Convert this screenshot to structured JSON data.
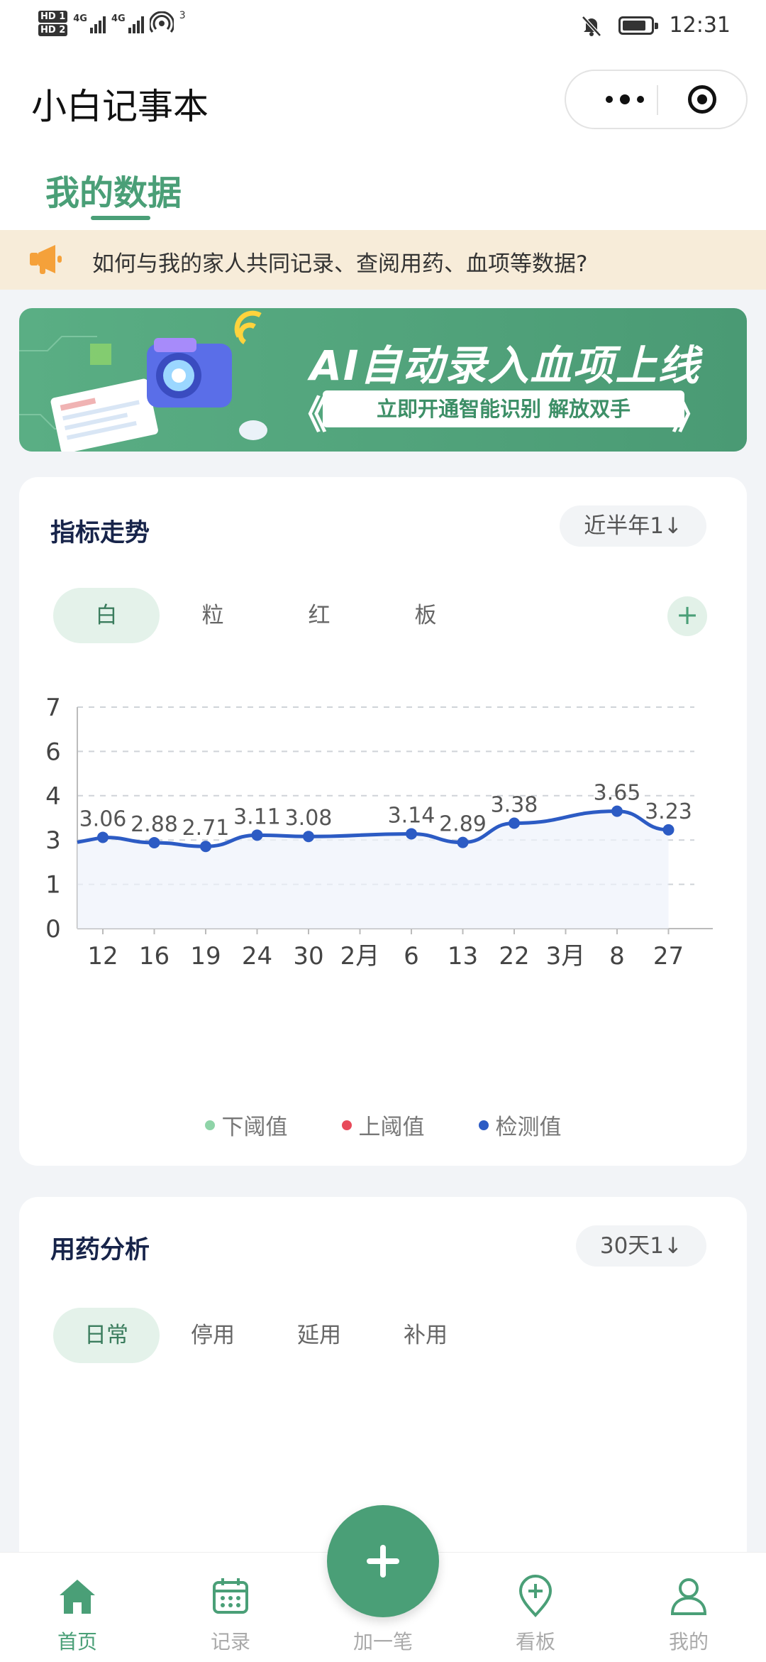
{
  "status_bar": {
    "hd1": "HD 1",
    "hd2": "HD 2",
    "net1": "4G",
    "net2": "4G",
    "hotspot_count": "3",
    "time": "12:31"
  },
  "app": {
    "title": "小白记事本"
  },
  "tabs": [
    {
      "label": "我的数据",
      "active": true
    }
  ],
  "notice": {
    "text": "如何与我的家人共同记录、查阅用药、血项等数据?"
  },
  "banner": {
    "title": "AI自动录入血项上线",
    "subtitle": "立即开通智能识别 解放双手",
    "chevron_left": "《",
    "chevron_right": "》"
  },
  "trend_card": {
    "title": "指标走势",
    "range": "近半年1↓",
    "chips": [
      {
        "label": "白",
        "active": true
      },
      {
        "label": "粒",
        "active": false
      },
      {
        "label": "红",
        "active": false
      },
      {
        "label": "板",
        "active": false
      }
    ],
    "add_label": "+"
  },
  "chart_data": {
    "type": "line",
    "categories": [
      "12",
      "16",
      "19",
      "24",
      "30",
      "2月",
      "6",
      "13",
      "22",
      "3月",
      "8",
      "27"
    ],
    "y_tick_labels": [
      "0",
      "1",
      "3",
      "4",
      "6",
      "7"
    ],
    "series": [
      {
        "name": "检测值",
        "color": "#2c5bc4",
        "points": [
          {
            "x": "12",
            "value": 3.06,
            "label": "3.06"
          },
          {
            "x": "16",
            "value": 2.88,
            "label": "2.88"
          },
          {
            "x": "19",
            "value": 2.71,
            "label": "2.71"
          },
          {
            "x": "24",
            "value": 3.11,
            "label": "3.11"
          },
          {
            "x": "30",
            "value": 3.08,
            "label": "3.08"
          },
          {
            "x": "6",
            "value": 3.14,
            "label": "3.14"
          },
          {
            "x": "13",
            "value": 2.89,
            "label": "2.89"
          },
          {
            "x": "22",
            "value": 3.38,
            "label": "3.38"
          },
          {
            "x": "8",
            "value": 3.65,
            "label": "3.65"
          },
          {
            "x": "27",
            "value": 3.23,
            "label": "3.23"
          }
        ]
      }
    ],
    "legend": [
      {
        "name": "下阈值",
        "color": "#8fd4a8"
      },
      {
        "name": "上阈值",
        "color": "#e84a5a"
      },
      {
        "name": "检测值",
        "color": "#2c5bc4"
      }
    ],
    "grid": true
  },
  "med_card": {
    "title": "用药分析",
    "range": "30天1↓",
    "chips": [
      {
        "label": "日常",
        "active": true
      },
      {
        "label": "停用",
        "active": false
      },
      {
        "label": "延用",
        "active": false
      },
      {
        "label": "补用",
        "active": false
      }
    ]
  },
  "bottom_nav": [
    {
      "label": "首页",
      "icon": "home-icon",
      "active": true
    },
    {
      "label": "记录",
      "icon": "calendar-icon",
      "active": false
    },
    {
      "label": "加一笔",
      "icon": "plus-icon",
      "active": false
    },
    {
      "label": "看板",
      "icon": "location-add-icon",
      "active": false
    },
    {
      "label": "我的",
      "icon": "user-icon",
      "active": false
    }
  ],
  "colors": {
    "brand": "#4a9f77",
    "line": "#2c5bc4",
    "notice_bg": "#f7ecd9"
  }
}
